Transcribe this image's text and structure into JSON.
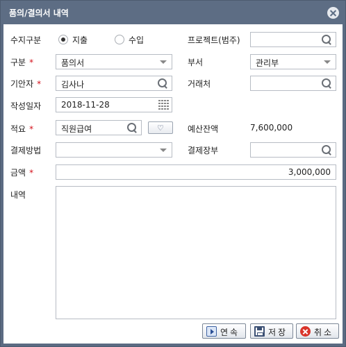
{
  "dialog": {
    "title": "품의/결의서 내역"
  },
  "form": {
    "income_type": {
      "label": "수지구분",
      "options": [
        "지출",
        "수입"
      ],
      "selected": "지출"
    },
    "project": {
      "label": "프로젝트(범주)",
      "value": ""
    },
    "category": {
      "label": "구분",
      "required_mark": "*",
      "value": "품의서"
    },
    "department": {
      "label": "부서",
      "value": "관리부"
    },
    "drafter": {
      "label": "기안자",
      "required_mark": "*",
      "value": "김사나"
    },
    "vendor": {
      "label": "거래처",
      "value": ""
    },
    "date": {
      "label": "작성일자",
      "value": "2018-11-28"
    },
    "summary": {
      "label": "적요",
      "required_mark": "*",
      "value": "직원급여"
    },
    "budget_balance": {
      "label": "예산잔액",
      "value": "7,600,000"
    },
    "payment_method": {
      "label": "결제방법",
      "value": ""
    },
    "payment_ledger": {
      "label": "결제장부",
      "value": ""
    },
    "amount": {
      "label": "금액",
      "required_mark": "*",
      "value": "3,000,000"
    },
    "details": {
      "label": "내역",
      "value": ""
    }
  },
  "buttons": {
    "continuous": "연속",
    "save": "저장",
    "cancel": "취소"
  }
}
